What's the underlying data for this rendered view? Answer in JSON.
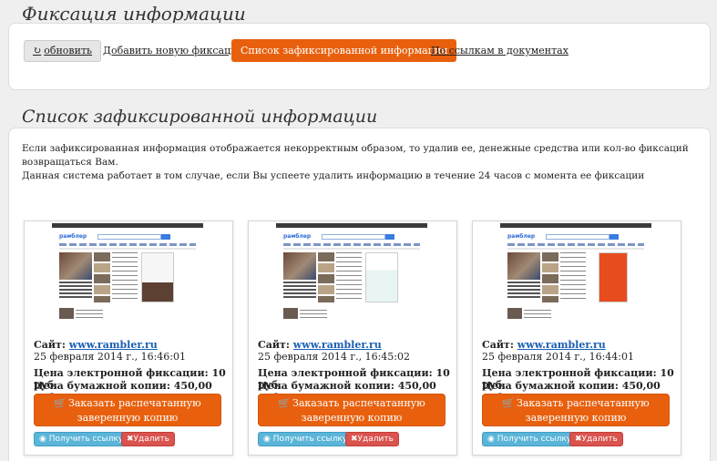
{
  "header": {
    "title": "Фиксация информации",
    "refresh_label": "обновить",
    "refresh_icon": "refresh-icon",
    "add_label": "Добавить новую фиксацию",
    "list_label": "Список зафиксированной информации",
    "links_label": "По ссылкам в документах",
    "accent_color": "#e8600e"
  },
  "list": {
    "title": "Список зафиксированной информации",
    "notice_line1": "Если зафиксированная информация отображается некорректным образом, то удалив ее, денежные средства или кол-во фиксаций возвращаться Вам.",
    "notice_line2": "Данная система работает в том случае, если Вы успеете удалить информацию в течение 24 часов с момента ее фиксации"
  },
  "cards": [
    {
      "site_label": "Сайт:",
      "site": "www.rambler.ru",
      "date": "25 февраля 2014 г., 16:46:01",
      "price_electronic": "Цена электронной фиксации: 10 руб.",
      "price_paper": "Цена бумажной копии: 450,00 руб.",
      "order_label": "Заказать распечатанную заверенную копию",
      "get_link_label": "Получить ссылку",
      "delete_label": "Удалить"
    },
    {
      "site_label": "Сайт:",
      "site": "www.rambler.ru",
      "date": "25 февраля 2014 г., 16:45:02",
      "price_electronic": "Цена электронной фиксации: 10 руб.",
      "price_paper": "Цена бумажной копии: 450,00 руб.",
      "order_label": "Заказать распечатанную заверенную копию",
      "get_link_label": "Получить ссылку",
      "delete_label": "Удалить"
    },
    {
      "site_label": "Сайт:",
      "site": "www.rambler.ru",
      "date": "25 февраля 2014 г., 16:44:01",
      "price_electronic": "Цена электронной фиксации: 10 руб.",
      "price_paper": "Цена бумажной копии: 450,00 руб.",
      "order_label": "Заказать распечатанную заверенную копию",
      "get_link_label": "Получить ссылку",
      "delete_label": "Удалить"
    }
  ]
}
